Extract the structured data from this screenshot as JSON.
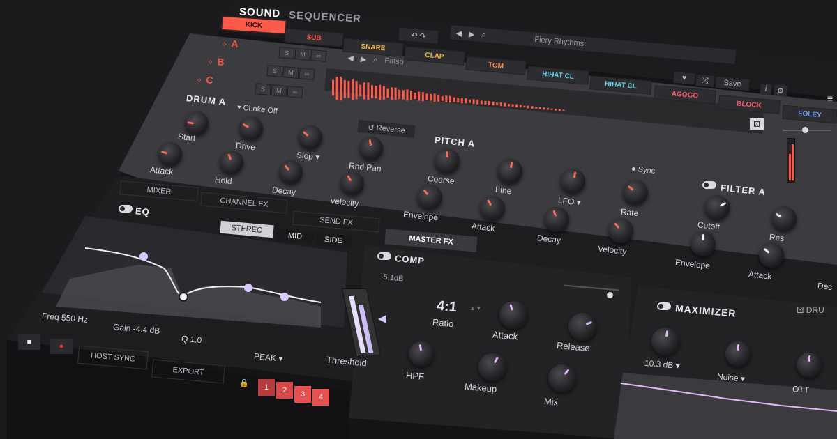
{
  "header": {
    "brand_left": "SOUND",
    "brand_right": "SEQUENCER"
  },
  "tabs": [
    {
      "label": "KICK",
      "color": "#ff5a48",
      "active": true
    },
    {
      "label": "SUB",
      "color": "#ff5a48"
    },
    {
      "label": "SNARE",
      "color": "#f5b942"
    },
    {
      "label": "CLAP",
      "color": "#f5b942"
    },
    {
      "label": "TOM",
      "color": "#ff8a4a"
    },
    {
      "label": "HIHAT CL",
      "color": "#5fd3e6"
    },
    {
      "label": "HIHAT CL",
      "color": "#5fd3e6"
    },
    {
      "label": "AGOGO",
      "color": "#ff5a6a"
    },
    {
      "label": "BLOCK",
      "color": "#ff5a6a"
    },
    {
      "label": "FOLEY",
      "color": "#6a9dff"
    }
  ],
  "rows": [
    {
      "label": "A",
      "s": "S",
      "m": "M",
      "link": "∞"
    },
    {
      "label": "B",
      "s": "S",
      "m": "M",
      "link": "∞"
    },
    {
      "label": "C",
      "s": "S",
      "m": "M",
      "link": "∞"
    }
  ],
  "preset": {
    "kit_name": "Fiery Rhythms",
    "sample_name": "Fatso",
    "save_label": "Save"
  },
  "drum": {
    "title": "DRUM A",
    "choke": "Choke Off",
    "reverse": "Reverse",
    "knobs": [
      "Start",
      "Drive",
      "Slop",
      "Rnd Pan",
      "Attack",
      "Hold",
      "Decay",
      "Velocity"
    ]
  },
  "pitch": {
    "title": "PITCH A",
    "sync": "Sync",
    "knobs": [
      "Coarse",
      "Fine",
      "LFO",
      "Rate",
      "Envelope",
      "Attack",
      "Decay",
      "Velocity"
    ]
  },
  "filter": {
    "title": "FILTER A",
    "knobs": [
      "Cutoff",
      "Res",
      "Envelope",
      "Attack",
      "Dec"
    ]
  },
  "fx_tabs": [
    "MIXER",
    "CHANNEL FX",
    "SEND FX",
    "MASTER FX"
  ],
  "eq": {
    "title": "EQ",
    "modes": [
      "STEREO",
      "MID",
      "SIDE"
    ],
    "freq": "Freq 550 Hz",
    "gain": "Gain -4.4 dB",
    "q": "Q 1.0",
    "type": "PEAK"
  },
  "comp": {
    "title": "COMP",
    "threshold_db": "-5.1dB",
    "ratio": "4:1",
    "labels": [
      "Ratio",
      "Attack",
      "Release",
      "Threshold",
      "HPF",
      "Makeup",
      "Mix"
    ]
  },
  "maximizer": {
    "title": "MAXIMIZER",
    "value": "10.3 dB",
    "labels": [
      "Noise",
      "OTT"
    ],
    "right_label": "DRU"
  },
  "footer": {
    "host_sync": "HOST SYNC",
    "export": "EXPORT",
    "pads": [
      "1",
      "2",
      "3",
      "4"
    ]
  },
  "colors": {
    "accent": "#ff5a48",
    "comp_accent": "#e6b8ff",
    "bg": "#1b1b1e"
  }
}
